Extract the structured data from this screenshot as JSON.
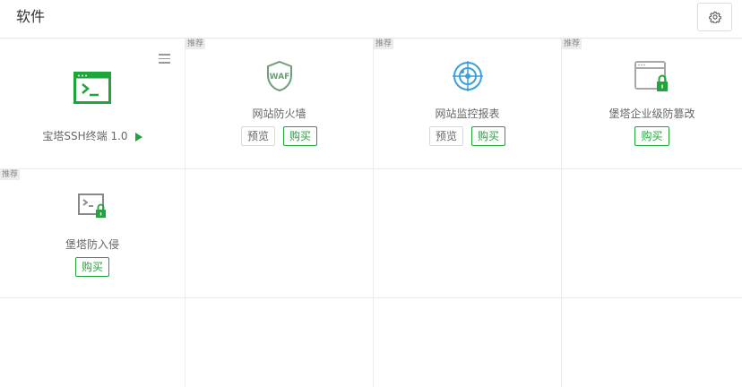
{
  "header": {
    "title": "软件",
    "settings_icon": "gear-icon"
  },
  "colors": {
    "accent": "#20a53a",
    "grid_line": "#eaecef",
    "badge_bg": "#ececec"
  },
  "apps": [
    {
      "name": "宝塔SSH终端 1.0",
      "icon": "terminal-icon",
      "installed": true,
      "menu_icon": "hamburger-icon",
      "play_icon": "play-icon"
    },
    {
      "name": "网站防火墙",
      "icon": "waf-shield-icon",
      "icon_text": "WAF",
      "badge": "推荐",
      "preview_label": "预览",
      "buy_label": "购买"
    },
    {
      "name": "网站监控报表",
      "icon": "radar-monitor-icon",
      "badge": "推荐",
      "preview_label": "预览",
      "buy_label": "购买"
    },
    {
      "name": "堡塔企业级防篡改",
      "icon": "browser-lock-icon",
      "badge": "推荐",
      "buy_label": "购买"
    },
    {
      "name": "堡塔防入侵",
      "icon": "terminal-lock-icon",
      "badge": "推荐",
      "buy_label": "购买"
    }
  ]
}
